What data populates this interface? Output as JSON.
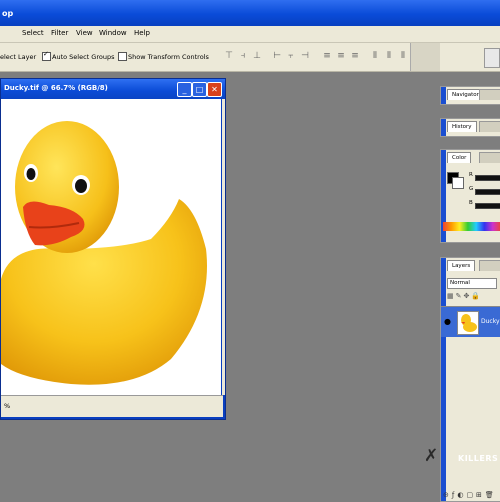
{
  "app": {
    "title_fragment": "op"
  },
  "menu": [
    "Select",
    "Filter",
    "View",
    "Window",
    "Help"
  ],
  "options": {
    "select_layer": "elect Layer",
    "auto_select_groups": "Auto Select Groups",
    "auto_select_groups_checked": true,
    "show_transform_controls": "Show Transform Controls",
    "show_transform_controls_checked": false
  },
  "document": {
    "title": "Ducky.tif @ 66.7% (RGB/8)",
    "zoom_status": "%",
    "image": "rubber-duck-photo"
  },
  "panels": {
    "navigator": {
      "tab": "Navigator"
    },
    "history": {
      "tab": "History"
    },
    "color": {
      "tab": "Color",
      "sliders": [
        "R",
        "G",
        "B"
      ]
    },
    "layers": {
      "tab": "Layers",
      "blend": "Normal",
      "layer_name": "Ducky"
    }
  },
  "watermark": {
    "text": "KILLERS"
  },
  "colors": {
    "titlebar": "#0a4bd8",
    "workspace": "#7e7e7e",
    "duck": "#f7c21a",
    "beak": "#e8421a"
  }
}
